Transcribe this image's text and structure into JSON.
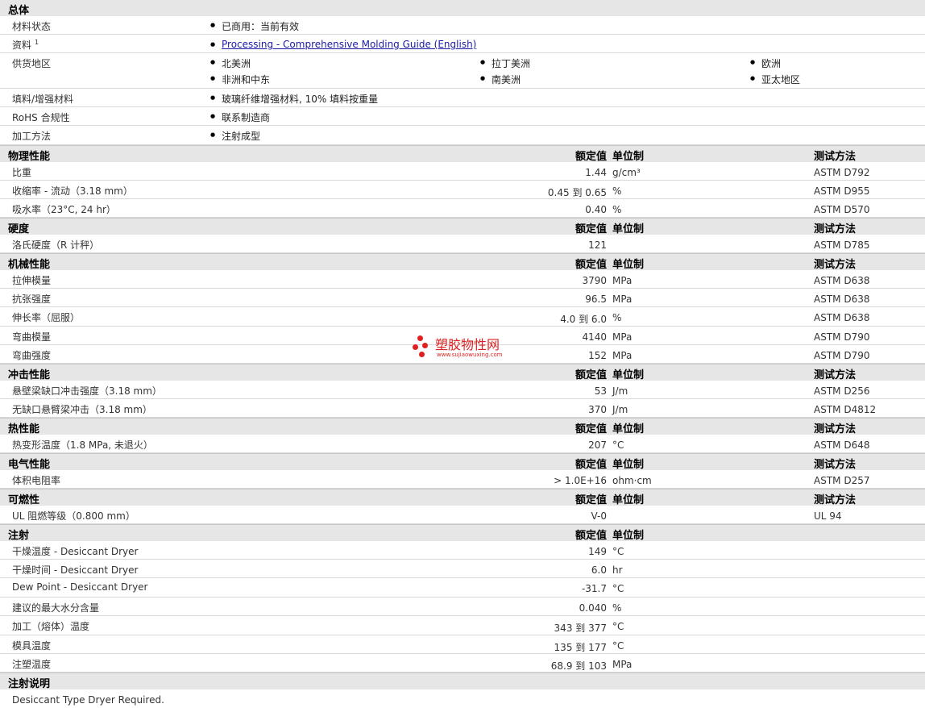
{
  "general": {
    "title": "总体",
    "material_status": {
      "label": "材料状态",
      "value": "已商用：当前有效"
    },
    "literature": {
      "label": "资料",
      "sup": "1",
      "link": "Processing - Comprehensive Molding Guide (English)"
    },
    "availability": {
      "label": "供货地区",
      "regions": [
        "北美洲",
        "拉丁美洲",
        "欧洲",
        "非洲和中东",
        "南美洲",
        "亚太地区"
      ]
    },
    "filler": {
      "label": "填料/增强材料",
      "value": "玻璃纤维增强材料, 10% 填料按重量"
    },
    "rohs": {
      "label": "RoHS 合规性",
      "value": "联系制造商"
    },
    "processing": {
      "label": "加工方法",
      "value": "注射成型"
    }
  },
  "headers": {
    "value": "额定值",
    "unit": "单位制",
    "method": "测试方法"
  },
  "sections": {
    "physical": {
      "title": "物理性能",
      "rows": [
        {
          "label": "比重",
          "value": "1.44",
          "unit": "g/cm³",
          "method": "ASTM D792"
        },
        {
          "label": "收缩率 - 流动（3.18 mm）",
          "value": "0.45 到  0.65",
          "unit": "%",
          "method": "ASTM D955"
        },
        {
          "label": "吸水率（23°C, 24 hr）",
          "value": "0.40",
          "unit": "%",
          "method": "ASTM D570"
        }
      ]
    },
    "hardness": {
      "title": "硬度",
      "rows": [
        {
          "label": "洛氏硬度（R 计秤）",
          "value": "121",
          "unit": "",
          "method": "ASTM D785"
        }
      ]
    },
    "mechanical": {
      "title": "机械性能",
      "rows": [
        {
          "label": "拉伸模量",
          "value": "3790",
          "unit": "MPa",
          "method": "ASTM D638"
        },
        {
          "label": "抗张强度",
          "value": "96.5",
          "unit": "MPa",
          "method": "ASTM D638"
        },
        {
          "label": "伸长率（屈服）",
          "value": "4.0 到  6.0",
          "unit": "%",
          "method": "ASTM D638"
        },
        {
          "label": "弯曲模量",
          "value": "4140",
          "unit": "MPa",
          "method": "ASTM D790"
        },
        {
          "label": "弯曲强度",
          "value": "152",
          "unit": "MPa",
          "method": "ASTM D790"
        }
      ]
    },
    "impact": {
      "title": "冲击性能",
      "rows": [
        {
          "label": "悬壁梁缺口冲击强度（3.18 mm）",
          "value": "53",
          "unit": "J/m",
          "method": "ASTM D256"
        },
        {
          "label": "无缺口悬臂梁冲击（3.18 mm）",
          "value": "370",
          "unit": "J/m",
          "method": "ASTM D4812"
        }
      ]
    },
    "thermal": {
      "title": "热性能",
      "rows": [
        {
          "label": "热变形温度（1.8 MPa, 未退火）",
          "value": "207",
          "unit": "°C",
          "method": "ASTM D648"
        }
      ]
    },
    "electrical": {
      "title": "电气性能",
      "rows": [
        {
          "label": "体积电阻率",
          "value": "> 1.0E+16",
          "unit": "ohm·cm",
          "method": "ASTM D257"
        }
      ]
    },
    "flammability": {
      "title": "可燃性",
      "rows": [
        {
          "label": "UL 阻燃等级（0.800 mm）",
          "value": "V-0",
          "unit": "",
          "method": "UL 94"
        }
      ]
    },
    "injection": {
      "title": "注射",
      "rows": [
        {
          "label": "干燥温度 - Desiccant Dryer",
          "value": "149",
          "unit": "°C",
          "method": ""
        },
        {
          "label": "干燥时间 - Desiccant Dryer",
          "value": "6.0",
          "unit": "hr",
          "method": ""
        },
        {
          "label": "Dew Point - Desiccant Dryer",
          "value": "-31.7",
          "unit": "°C",
          "method": ""
        },
        {
          "label": "建议的最大水分含量",
          "value": "0.040",
          "unit": "%",
          "method": ""
        },
        {
          "label": "加工（熔体）温度",
          "value": "343 到  377",
          "unit": "°C",
          "method": ""
        },
        {
          "label": "模具温度",
          "value": "135 到  177",
          "unit": "°C",
          "method": ""
        },
        {
          "label": "注塑温度",
          "value": "68.9 到  103",
          "unit": "MPa",
          "method": ""
        }
      ]
    }
  },
  "injection_notes": {
    "title": "注射说明",
    "text": "Desiccant Type Dryer Required."
  },
  "watermark": {
    "cn": "塑胶物性网",
    "url": "www.sujiaowuxing.com",
    "color": "#e02020"
  }
}
